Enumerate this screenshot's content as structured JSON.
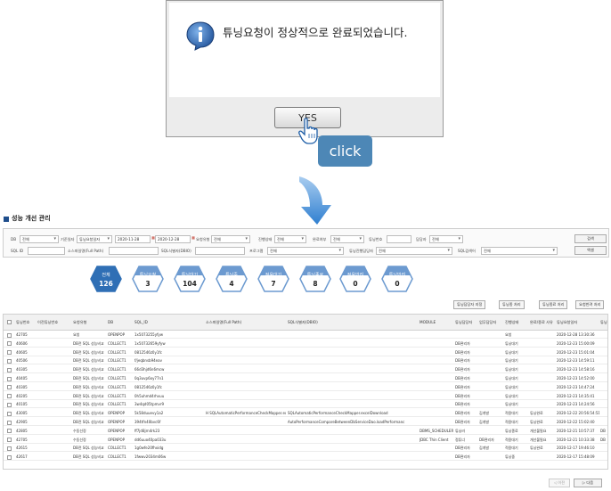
{
  "dialog": {
    "message": "튜닝요청이 정상적으로 완료되었습니다.",
    "yes_label": "YES",
    "icon": "info-icon"
  },
  "callout": {
    "label": "click",
    "color": "#4d87b6"
  },
  "page": {
    "title": "성능 개선 관리"
  },
  "filters": {
    "db_label": "DB",
    "db_value": "전체",
    "period_label": "기준일자",
    "period_type": "튜닝요청일자",
    "date_from": "2020-11-28",
    "date_to": "2020-12-28",
    "selection_type_label": "요청유형",
    "selection_type_value": "전체",
    "progress_label": "진행상태",
    "progress_value": "전체",
    "completion_label": "완료여부",
    "completion_value": "전체",
    "tuning_no_label": "튜닝번호",
    "owner_label": "담당자",
    "owner_value": "전체",
    "sql_id_label": "SQL ID",
    "source_file_label": "소스파일명(Full Path)",
    "sql_id_dbio_label": "SQL식별자(DBIO)",
    "program_label": "프로그램",
    "program_value": "전체",
    "tuner_label": "튜닝진행담당자",
    "tuner_value": "전체",
    "sql_search_label": "SQL검색어",
    "sql_search_value": "전체",
    "search_button": "검색",
    "excel_button": "엑셀"
  },
  "statuses": [
    {
      "label": "전체",
      "value": "126",
      "active": true
    },
    {
      "label": "튜닝요청",
      "value": "3",
      "active": false
    },
    {
      "label": "튜닝대기",
      "value": "104",
      "active": false
    },
    {
      "label": "튜닝중",
      "value": "4",
      "active": false
    },
    {
      "label": "적용대기",
      "value": "7",
      "active": false
    },
    {
      "label": "튜닝종료",
      "value": "8",
      "active": false
    },
    {
      "label": "적용반려",
      "value": "0",
      "active": false
    },
    {
      "label": "튜닝반려",
      "value": "0",
      "active": false
    }
  ],
  "status_colors": {
    "active": "#2f6fb5",
    "normal": "#6c9ad0"
  },
  "actions": [
    "튜닝담당자 지정",
    "튜닝종 처리",
    "튜닝종료 처리",
    "요청반려 처리"
  ],
  "grid": {
    "headers": [
      "튜닝번호",
      "이전튜닝번호",
      "요청유형",
      "DB",
      "SQL_ID",
      "소스파일명(Full Path)",
      "SQL식별자(DBIO)",
      "MODULE",
      "튜닝담당자",
      "업무담당자",
      "진행상태",
      "완료/종료 사유",
      "튜닝요청일자",
      "튜닝"
    ],
    "rows": [
      [
        "42705",
        "",
        "요청",
        "OPENPOP",
        "1x5073255yfyw",
        "",
        "",
        "",
        "",
        "",
        "요청",
        "",
        "2020-12-28 13:30:36",
        ""
      ],
      [
        "40606",
        "",
        "DB전 SQL 성능비교",
        "COLLECT1",
        "1x50732659yfyw",
        "",
        "",
        "",
        "DB관리자",
        "",
        "튜닝대기",
        "",
        "2020-12-23 15:00:09",
        ""
      ],
      [
        "40605",
        "",
        "DB전 SQL 성능비교",
        "COLLECT1",
        "0812546z0y1fc",
        "",
        "",
        "",
        "DB관리자",
        "",
        "튜닝대기",
        "",
        "2020-12-23 15:01:04",
        ""
      ],
      [
        "40506",
        "",
        "DB전 SQL 성능비교",
        "COLLECT1",
        "f/jeqbnsb94eav",
        "",
        "",
        "",
        "DB관리자",
        "",
        "튜닝대기",
        "",
        "2020-12-23 14:59:11",
        ""
      ],
      [
        "40305",
        "",
        "DB전 SQL 성능비교",
        "COLLECT1",
        "66d3hjd6n6mcw",
        "",
        "",
        "",
        "DB관리자",
        "",
        "튜닝대기",
        "",
        "2020-12-23 14:58:16",
        ""
      ],
      [
        "40405",
        "",
        "DB전 SQL 성능비교",
        "COLLECT1",
        "0q3uvp6oy77n1",
        "",
        "",
        "",
        "DB관리자",
        "",
        "튜닝대기",
        "",
        "2020-12-23 14:52:00",
        ""
      ],
      [
        "40305",
        "",
        "DB전 SQL 성능비교",
        "COLLECT1",
        "0812546z0y1fc",
        "",
        "",
        "",
        "DB관리자",
        "",
        "튜닝대기",
        "",
        "2020-12-23 14:47:24",
        ""
      ],
      [
        "40205",
        "",
        "DB전 SQL 성능비교",
        "COLLECT1",
        "0h5uhmd4rhvuu",
        "",
        "",
        "",
        "DB관리자",
        "",
        "튜닝대기",
        "",
        "2020-12-23 14:35:41",
        ""
      ],
      [
        "40105",
        "",
        "DB전 SQL 성능비교",
        "COLLECT1",
        "3w4qd05tpmvr9",
        "",
        "",
        "",
        "DB관리자",
        "",
        "튜닝대기",
        "",
        "2020-12-23 14:24:56",
        ""
      ],
      [
        "43005",
        "",
        "DB전 SQL 성능비교",
        "OPENPOP",
        "5k58duuevy1a2",
        "H SQLAutomaticPerformanceCheckMapper.excelDownload H",
        "SQLAutomaticPerformanceCheckMapper.excelDownload",
        "",
        "DB관리자",
        "김개발",
        "적용대기",
        "튜닝완료",
        "2020-12-22 20:56:54:51",
        ""
      ],
      [
        "42905",
        "",
        "DB전 SQL 성능비교",
        "OPENPOP",
        "394tfn40bvc6f",
        "",
        "AutoPerformanceCompareBetweenDbServiceDao.loadPerformanc",
        "",
        "DB관리자",
        "김개발",
        "적용대기",
        "튜닝완료",
        "2020-12-22 15:02:40",
        ""
      ],
      [
        "42805",
        "",
        "수동선정",
        "OPENPOP",
        "ff7jd8jrn4rk23",
        "",
        "",
        "DBMS_SCHEDULER",
        "튜닝러",
        "",
        "튜닝종료",
        "개선불필요",
        "2020-12-21 10:57:37",
        "DB"
      ],
      [
        "42705",
        "",
        "수동선정",
        "OPENPOP",
        "dd6uuo40pa033u",
        "",
        "",
        "JDBC Thin Client",
        "정튜너",
        "DB관리자",
        "적용대기",
        "개선불필요",
        "2020-12-21 10:33:38",
        "DB"
      ],
      [
        "42615",
        "",
        "DB전 SQL 성능비교",
        "COLLECT1",
        "1g0wfe20fhxidg",
        "",
        "",
        "",
        "DB관리자",
        "김개발",
        "적용대기",
        "튜닝완료",
        "2020-12-17 19:46:10",
        ""
      ],
      [
        "42617",
        "",
        "DB전 SQL 성능비교",
        "COLLECT1",
        "1fwwv2034m06w",
        "",
        "",
        "",
        "DB관리자",
        "",
        "튜닝중",
        "",
        "2020-12-17 15:48:09",
        ""
      ]
    ]
  },
  "pager": {
    "prev": "◁ 이전",
    "next": "▷ 다음"
  }
}
